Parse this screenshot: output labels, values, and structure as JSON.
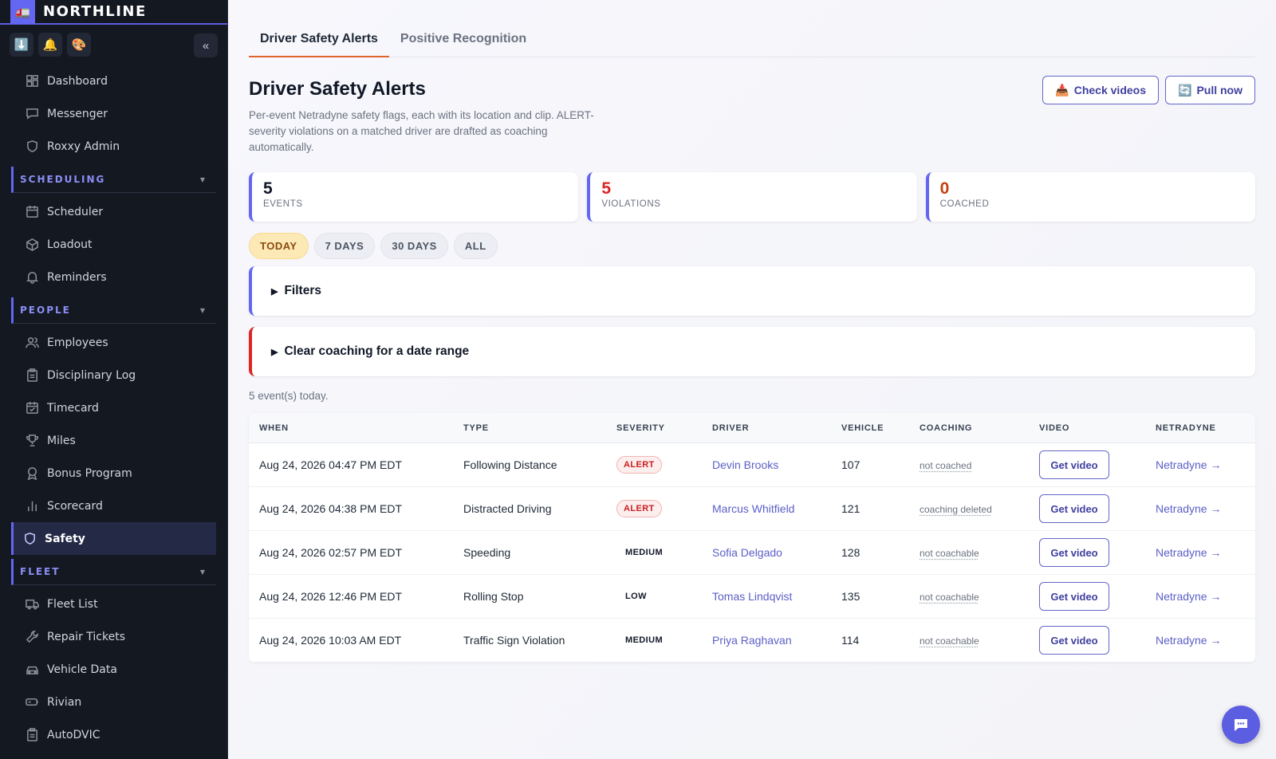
{
  "brand": {
    "name": "NORTHLINE",
    "logo_glyph": "🚛"
  },
  "quick_actions": [
    {
      "icon": "download-icon",
      "glyph": "⬇️"
    },
    {
      "icon": "bell-icon",
      "glyph": "🔔"
    },
    {
      "icon": "palette-icon",
      "glyph": "🎨"
    }
  ],
  "collapse_glyph": "«",
  "sidebar": {
    "top_items": [
      {
        "label": "Dashboard",
        "icon": "dashboard-icon"
      },
      {
        "label": "Messenger",
        "icon": "chat-icon"
      },
      {
        "label": "Roxxy Admin",
        "icon": "shield-icon"
      }
    ],
    "sections": [
      {
        "title": "SCHEDULING",
        "items": [
          {
            "label": "Scheduler",
            "icon": "calendar-icon"
          },
          {
            "label": "Loadout",
            "icon": "box-icon"
          },
          {
            "label": "Reminders",
            "icon": "bell-icon"
          }
        ]
      },
      {
        "title": "PEOPLE",
        "items": [
          {
            "label": "Employees",
            "icon": "users-icon"
          },
          {
            "label": "Disciplinary Log",
            "icon": "clipboard-icon"
          },
          {
            "label": "Timecard",
            "icon": "calendar-check-icon"
          },
          {
            "label": "Miles",
            "icon": "trophy-icon"
          },
          {
            "label": "Bonus Program",
            "icon": "award-icon"
          },
          {
            "label": "Scorecard",
            "icon": "bar-chart-icon"
          },
          {
            "label": "Safety",
            "icon": "shield-icon",
            "active": true
          }
        ]
      },
      {
        "title": "FLEET",
        "items": [
          {
            "label": "Fleet List",
            "icon": "truck-icon"
          },
          {
            "label": "Repair Tickets",
            "icon": "wrench-icon"
          },
          {
            "label": "Vehicle Data",
            "icon": "car-icon"
          },
          {
            "label": "Rivian",
            "icon": "battery-icon"
          },
          {
            "label": "AutoDVIC",
            "icon": "clipboard-icon"
          }
        ]
      }
    ]
  },
  "tabs": [
    {
      "label": "Driver Safety Alerts",
      "active": true
    },
    {
      "label": "Positive Recognition",
      "active": false
    }
  ],
  "page": {
    "title": "Driver Safety Alerts",
    "description": "Per-event Netradyne safety flags, each with its location and clip. ALERT-severity violations on a matched driver are drafted as coaching automatically."
  },
  "actions": {
    "check_videos": {
      "glyph": "📥",
      "label": "Check videos"
    },
    "pull_now": {
      "glyph": "🔄",
      "label": "Pull now"
    }
  },
  "stats": [
    {
      "value": "5",
      "label": "EVENTS",
      "tone": "default"
    },
    {
      "value": "5",
      "label": "VIOLATIONS",
      "tone": "red"
    },
    {
      "value": "0",
      "label": "COACHED",
      "tone": "orange"
    }
  ],
  "ranges": [
    {
      "label": "TODAY",
      "active": true
    },
    {
      "label": "7 DAYS",
      "active": false
    },
    {
      "label": "30 DAYS",
      "active": false
    },
    {
      "label": "ALL",
      "active": false
    }
  ],
  "panels": {
    "filters": {
      "glyph": "▶",
      "label": "Filters"
    },
    "clear": {
      "glyph": "▶",
      "label": "Clear coaching for a date range"
    }
  },
  "count_text": "5 event(s) today.",
  "table": {
    "columns": [
      "WHEN",
      "TYPE",
      "SEVERITY",
      "DRIVER",
      "VEHICLE",
      "COACHING",
      "VIDEO",
      "NETRADYNE"
    ],
    "rows": [
      {
        "when": "Aug 24, 2026 04:47 PM EDT",
        "type": "Following Distance",
        "severity": "ALERT",
        "driver": "Devin Brooks",
        "vehicle": "107",
        "coaching": "not coached",
        "video": "Get video",
        "netradyne": "Netradyne →"
      },
      {
        "when": "Aug 24, 2026 04:38 PM EDT",
        "type": "Distracted Driving",
        "severity": "ALERT",
        "driver": "Marcus Whitfield",
        "vehicle": "121",
        "coaching": "coaching deleted",
        "video": "Get video",
        "netradyne": "Netradyne →"
      },
      {
        "when": "Aug 24, 2026 02:57 PM EDT",
        "type": "Speeding",
        "severity": "MEDIUM",
        "driver": "Sofia Delgado",
        "vehicle": "128",
        "coaching": "not coachable",
        "video": "Get video",
        "netradyne": "Netradyne →"
      },
      {
        "when": "Aug 24, 2026 12:46 PM EDT",
        "type": "Rolling Stop",
        "severity": "LOW",
        "driver": "Tomas Lindqvist",
        "vehicle": "135",
        "coaching": "not coachable",
        "video": "Get video",
        "netradyne": "Netradyne →"
      },
      {
        "when": "Aug 24, 2026 10:03 AM EDT",
        "type": "Traffic Sign Violation",
        "severity": "MEDIUM",
        "driver": "Priya Raghavan",
        "vehicle": "114",
        "coaching": "not coachable",
        "video": "Get video",
        "netradyne": "Netradyne →"
      }
    ]
  },
  "colors": {
    "accent": "#6366f1",
    "alert_red": "#dc2626",
    "tab_underline": "#e0642e",
    "sidebar_bg": "#141821"
  }
}
